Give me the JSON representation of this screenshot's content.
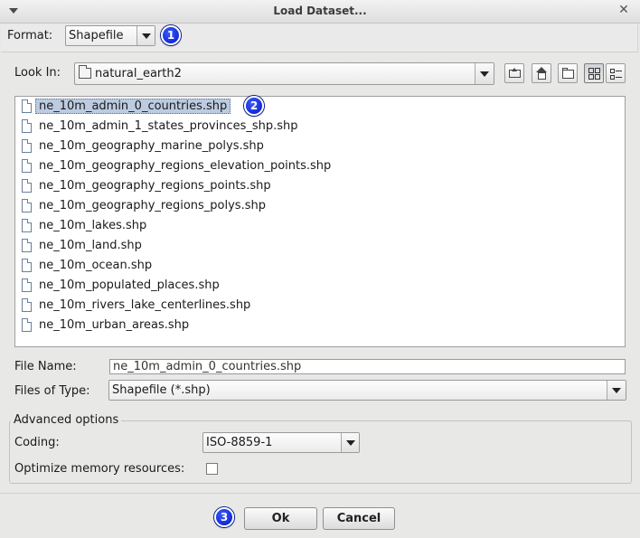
{
  "window": {
    "title": "Load Dataset..."
  },
  "format": {
    "label": "Format:",
    "value": "Shapefile",
    "badge": "1"
  },
  "look_in": {
    "label": "Look In:",
    "value": "natural_earth2"
  },
  "toolbar_icons": [
    "up-one-level-icon",
    "home-icon",
    "new-folder-icon",
    "list-view-icon",
    "details-view-icon"
  ],
  "files": [
    "ne_10m_admin_0_countries.shp",
    "ne_10m_admin_1_states_provinces_shp.shp",
    "ne_10m_geography_marine_polys.shp",
    "ne_10m_geography_regions_elevation_points.shp",
    "ne_10m_geography_regions_points.shp",
    "ne_10m_geography_regions_polys.shp",
    "ne_10m_lakes.shp",
    "ne_10m_land.shp",
    "ne_10m_ocean.shp",
    "ne_10m_populated_places.shp",
    "ne_10m_rivers_lake_centerlines.shp",
    "ne_10m_urban_areas.shp"
  ],
  "selected_file_badge": "2",
  "file_name": {
    "label": "File Name:",
    "value": "ne_10m_admin_0_countries.shp"
  },
  "files_of_type": {
    "label": "Files of Type:",
    "value": "Shapefile (*.shp)"
  },
  "advanced": {
    "title": "Advanced options",
    "coding_label": "Coding:",
    "coding_value": "ISO-8859-1",
    "optimize_label": "Optimize memory resources:",
    "optimize_checked": false
  },
  "buttons": {
    "badge": "3",
    "ok": "Ok",
    "cancel": "Cancel"
  },
  "colors": {
    "badge_blue": "#0a28e6",
    "selection": "#bccbe0"
  }
}
